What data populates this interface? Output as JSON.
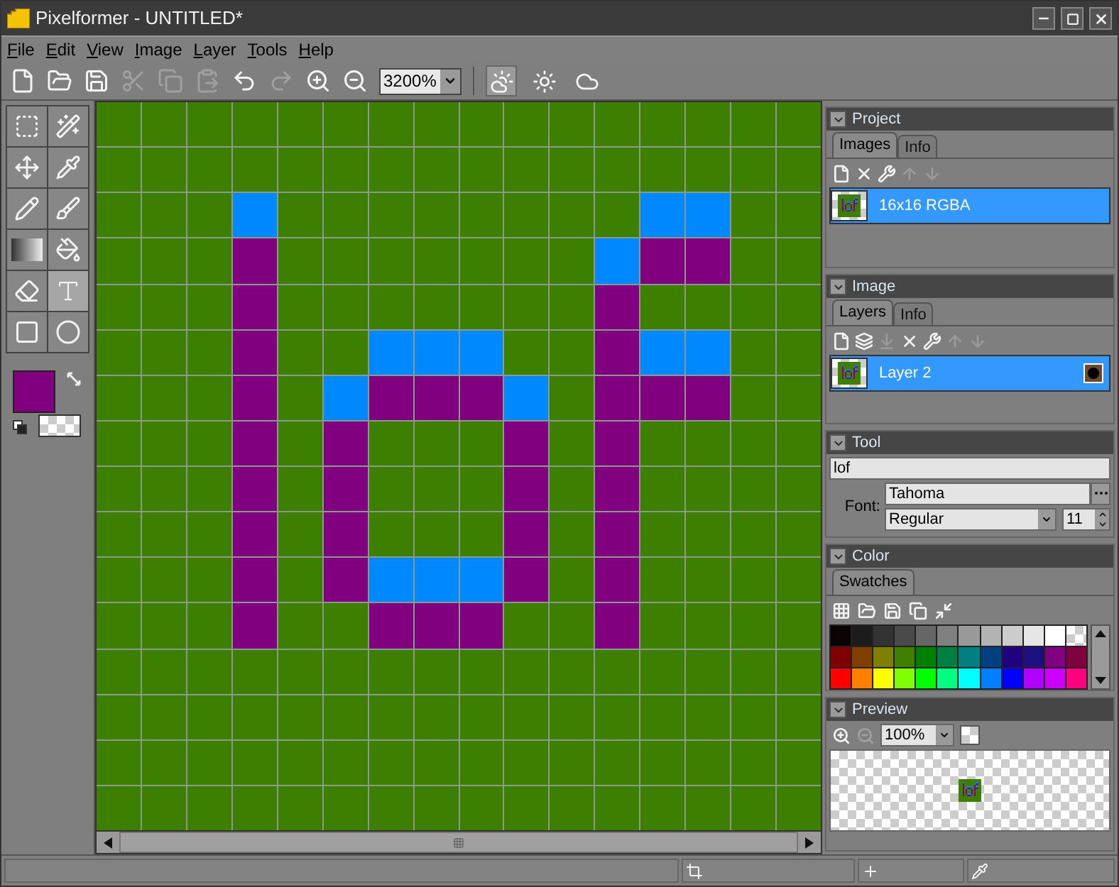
{
  "window": {
    "title": "Pixelformer - UNTITLED*"
  },
  "menu": [
    "File",
    "Edit",
    "View",
    "Image",
    "Layer",
    "Tools",
    "Help"
  ],
  "toolbar": [
    {
      "kind": "new",
      "disabled": false
    },
    {
      "kind": "open",
      "disabled": false
    },
    {
      "kind": "save",
      "disabled": false
    },
    {
      "kind": "cut",
      "disabled": true
    },
    {
      "kind": "copy",
      "disabled": true
    },
    {
      "kind": "paste",
      "disabled": true
    },
    {
      "kind": "undo",
      "disabled": false
    },
    {
      "kind": "redo",
      "disabled": true
    },
    {
      "kind": "zoom-in",
      "disabled": false
    },
    {
      "kind": "zoom-out",
      "disabled": false
    }
  ],
  "zoom": "3200%",
  "view_modes": [
    {
      "kind": "cloud-sun",
      "selected": true
    },
    {
      "kind": "sun",
      "selected": false
    },
    {
      "kind": "cloud",
      "selected": false
    }
  ],
  "tools": [
    {
      "kind": "select",
      "selected": false
    },
    {
      "kind": "wand",
      "selected": false
    },
    {
      "kind": "move",
      "selected": false
    },
    {
      "kind": "pipette",
      "selected": false
    },
    {
      "kind": "pencil",
      "selected": false
    },
    {
      "kind": "brush",
      "selected": false
    },
    {
      "kind": "gradient",
      "selected": false
    },
    {
      "kind": "fill",
      "selected": false
    },
    {
      "kind": "eraser",
      "selected": false
    },
    {
      "kind": "text",
      "selected": true
    },
    {
      "kind": "rectangle",
      "selected": false
    },
    {
      "kind": "ellipse",
      "selected": false
    }
  ],
  "foreground": {
    "color": "#800080"
  },
  "project": {
    "title": "Project",
    "tabs": [
      {
        "label": "Images",
        "selected": true
      },
      {
        "label": "Info",
        "selected": false
      }
    ],
    "actions": [
      {
        "kind": "new",
        "disabled": false
      },
      {
        "kind": "delete",
        "disabled": false
      },
      {
        "kind": "properties",
        "disabled": false
      },
      {
        "kind": "up",
        "disabled": true
      },
      {
        "kind": "down",
        "disabled": true
      }
    ],
    "images": [
      {
        "label": "16x16 RGBA",
        "selected": true
      }
    ]
  },
  "image": {
    "title": "Image",
    "tabs": [
      {
        "label": "Layers",
        "selected": true
      },
      {
        "label": "Info",
        "selected": false
      }
    ],
    "actions": [
      {
        "kind": "new",
        "disabled": false
      },
      {
        "kind": "duplicate",
        "disabled": false
      },
      {
        "kind": "merge",
        "disabled": true
      },
      {
        "kind": "delete",
        "disabled": false
      },
      {
        "kind": "properties",
        "disabled": false
      },
      {
        "kind": "up",
        "disabled": true
      },
      {
        "kind": "down",
        "disabled": true
      }
    ],
    "layers": [
      {
        "label": "Layer 2",
        "selected": true,
        "visible": true
      }
    ]
  },
  "tool": {
    "title": "Tool",
    "text": "lof",
    "font_label": "Font:",
    "font": "Tahoma",
    "style": "Regular",
    "size": "11"
  },
  "color": {
    "title": "Color",
    "tabs": [
      {
        "label": "Swatches",
        "selected": true
      }
    ],
    "swatches": [
      {
        "color": "#0a0404"
      },
      {
        "color": "#1c1c1c"
      },
      {
        "color": "#333333"
      },
      {
        "color": "#4a4a4a"
      },
      {
        "color": "#666666"
      },
      {
        "color": "#808080"
      },
      {
        "color": "#999999"
      },
      {
        "color": "#b3b3b3"
      },
      {
        "color": "#cccccc"
      },
      {
        "color": "#e6e6e6"
      },
      {
        "color": "#ffffff"
      },
      {
        "kind": "transparent"
      },
      {
        "color": "#800000"
      },
      {
        "color": "#804000"
      },
      {
        "color": "#808000"
      },
      {
        "color": "#408000"
      },
      {
        "color": "#008000"
      },
      {
        "color": "#008040"
      },
      {
        "color": "#008080"
      },
      {
        "color": "#004080"
      },
      {
        "color": "#200080"
      },
      {
        "color": "#1f1080"
      },
      {
        "color": "#800080"
      },
      {
        "color": "#800040"
      },
      {
        "color": "#ff0000"
      },
      {
        "color": "#ff8000"
      },
      {
        "color": "#ffff00"
      },
      {
        "color": "#80ff00"
      },
      {
        "color": "#00ff00"
      },
      {
        "color": "#00ff80"
      },
      {
        "color": "#00ffff"
      },
      {
        "color": "#0080ff"
      },
      {
        "color": "#0000ff"
      },
      {
        "color": "#b000ff"
      },
      {
        "color": "#cc00ff"
      },
      {
        "color": "#ff0080"
      }
    ]
  },
  "preview": {
    "title": "Preview",
    "zoom": "100%"
  }
}
